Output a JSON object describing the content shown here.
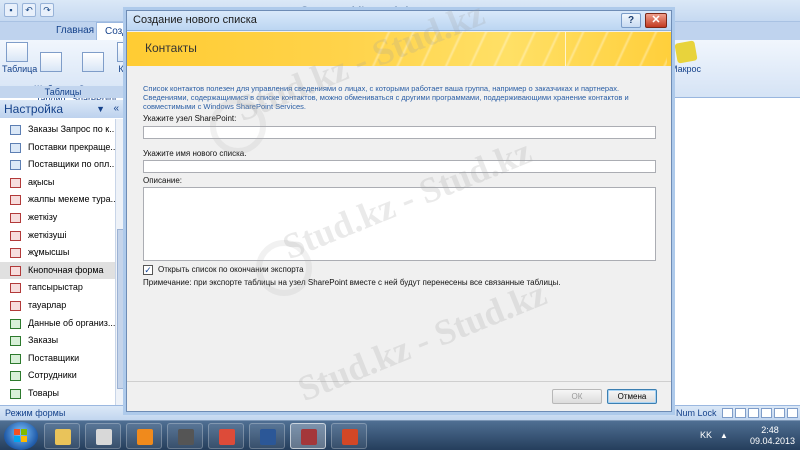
{
  "app": {
    "window_title": "Отчеты : Microsoft Access",
    "tabs": [
      "Главная",
      "Созда"
    ],
    "ribbon_items": [
      {
        "label": "Таблица",
        "icon": "table-icon"
      },
      {
        "label": "Шаблоны\nтаблиц",
        "icon": "table-templates-icon"
      },
      {
        "label": "Списки\nSharePoint",
        "icon": "sharepoint-lists-icon"
      },
      {
        "label": "К",
        "icon": "table-design-icon"
      }
    ],
    "ribbon_group": "Таблицы",
    "macro_label": "Макрос"
  },
  "navpane": {
    "title": "Настройка",
    "items": [
      {
        "label": "Заказы Запрос по к...",
        "icon": "query"
      },
      {
        "label": "Поставки прекраще...",
        "icon": "query"
      },
      {
        "label": "Поставщики по опл...",
        "icon": "query"
      },
      {
        "label": "ақысы",
        "icon": "form"
      },
      {
        "label": "жалпы мекеме тура...",
        "icon": "form"
      },
      {
        "label": "жеткізу",
        "icon": "form"
      },
      {
        "label": "жеткізуші",
        "icon": "form"
      },
      {
        "label": "жұмысшы",
        "icon": "form"
      },
      {
        "label": "Кнопочная форма",
        "icon": "form",
        "selected": true
      },
      {
        "label": "тапсырыстар",
        "icon": "form"
      },
      {
        "label": "тауарлар",
        "icon": "form"
      },
      {
        "label": "Данные об организ...",
        "icon": "table"
      },
      {
        "label": "Заказы",
        "icon": "table"
      },
      {
        "label": "Поставщики",
        "icon": "table"
      },
      {
        "label": "Сотрудники",
        "icon": "table"
      },
      {
        "label": "Товары",
        "icon": "table"
      }
    ]
  },
  "status": {
    "mode": "Режим формы",
    "numlock": "Num Lock"
  },
  "dialog": {
    "title": "Создание нового списка",
    "help": "?",
    "close": "✕",
    "heading": "Контакты",
    "description": "Список контактов полезен для управления сведениями о лицах, с которыми работает ваша группа, например о заказчиках и партнерах. Сведениями, содержащимися в списке контактов, можно обмениваться с другими программами, поддерживающими хранение контактов и совместимыми с Windows SharePoint Services.",
    "sharepoint_label": "Укажите узел SharePoint:",
    "sharepoint_value": "",
    "listname_label": "Укажите имя нового списка.",
    "listname_value": "",
    "desc_label": "Описание:",
    "desc_value": "",
    "open_checkbox_label": "Открыть список по окончании экспорта",
    "open_checked": true,
    "note": "Примечание: при экспорте таблицы на узел SharePoint вместе с ней будут перенесены все связанные таблицы.",
    "ok": "ОК",
    "cancel": "Отмена"
  },
  "watermark": "Stud.kz - Stud.kz",
  "taskbar": {
    "apps": [
      {
        "name": "explorer",
        "color": "#e9c35a"
      },
      {
        "name": "media-player-classic",
        "color": "#d8d8d8"
      },
      {
        "name": "media-player",
        "color": "#f08a1c"
      },
      {
        "name": "video",
        "color": "#555555"
      },
      {
        "name": "chrome",
        "color": "#dd4b39"
      },
      {
        "name": "word",
        "color": "#2b5797"
      },
      {
        "name": "access",
        "color": "#a4373a",
        "active": true
      },
      {
        "name": "presentation",
        "color": "#d24726"
      }
    ],
    "lang": "KK",
    "time": "2:48",
    "date": "09.04.2013"
  }
}
